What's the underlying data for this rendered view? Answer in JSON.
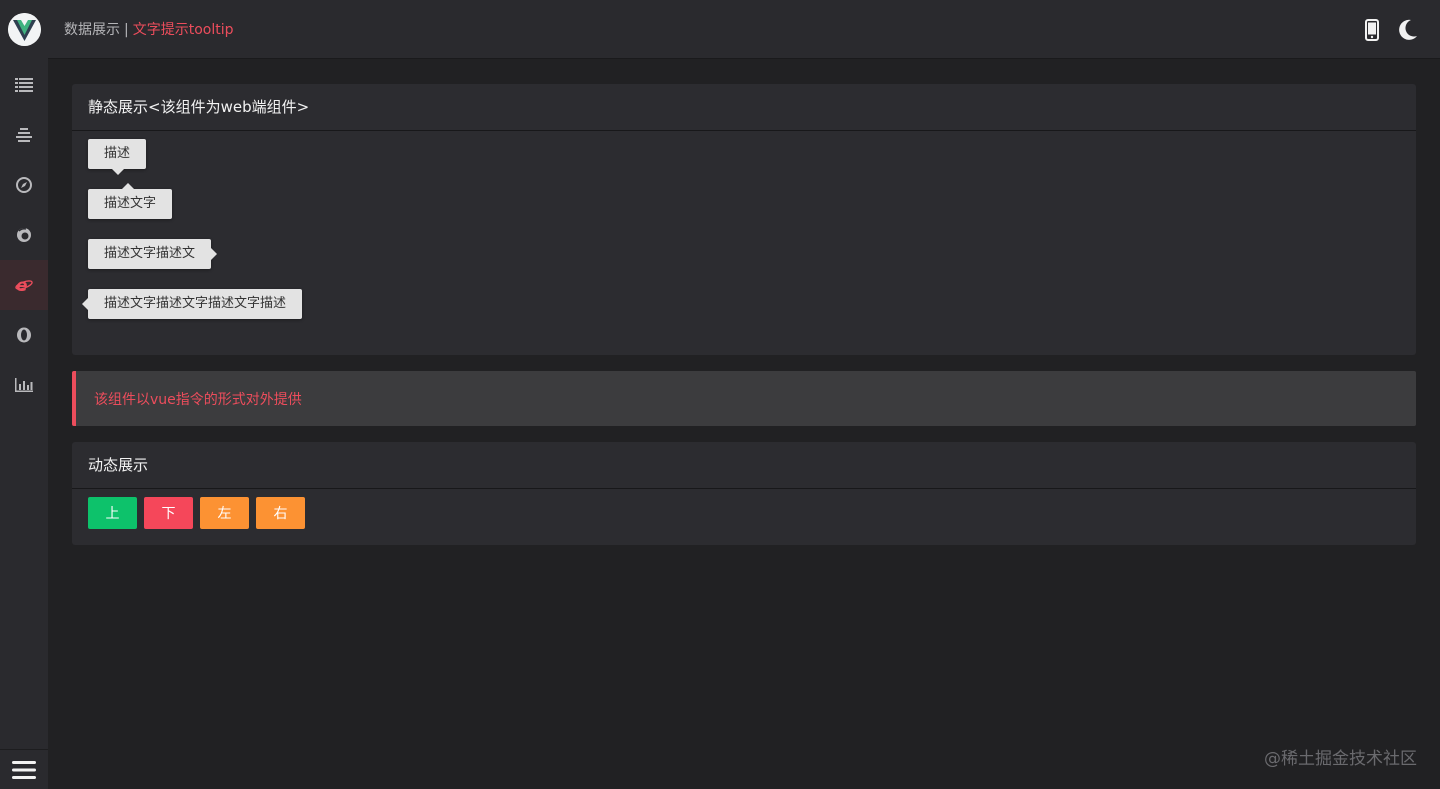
{
  "header": {
    "breadcrumb_home": "数据展示",
    "breadcrumb_separator": "|",
    "breadcrumb_current": "文字提示tooltip",
    "actions": [
      {
        "icon": "mobile-icon"
      },
      {
        "icon": "moon-icon"
      }
    ]
  },
  "sidebar": {
    "logo_icon": "vue-logo-icon",
    "items": [
      {
        "icon": "list-icon",
        "active": false
      },
      {
        "icon": "align-center-icon",
        "active": false
      },
      {
        "icon": "compass-icon",
        "active": false
      },
      {
        "icon": "firefox-icon",
        "active": false
      },
      {
        "icon": "ie-browser-icon",
        "active": true
      },
      {
        "icon": "opera-icon",
        "active": false
      },
      {
        "icon": "bar-chart-icon",
        "active": false
      }
    ],
    "menu_toggle_icon": "hamburger-menu-icon"
  },
  "static_demo": {
    "title": "静态展示<该组件为web端组件>",
    "tooltips": [
      {
        "text": "描述",
        "placement": "top"
      },
      {
        "text": "描述文字",
        "placement": "bottom"
      },
      {
        "text": "描述文字描述文",
        "placement": "left"
      },
      {
        "text": "描述文字描述文字描述文字描述",
        "placement": "right"
      }
    ]
  },
  "notice": {
    "text": "该组件以vue指令的形式对外提供"
  },
  "dynamic_demo": {
    "title": "动态展示",
    "buttons": [
      {
        "label": "上",
        "color": "#0dc26b"
      },
      {
        "label": "下",
        "color": "#f5475a"
      },
      {
        "label": "左",
        "color": "#fc9233"
      },
      {
        "label": "右",
        "color": "#fc9233"
      }
    ]
  },
  "watermark": "@稀土掘金技术社区",
  "colors": {
    "accent": "#ec4d5c",
    "background": "#212123",
    "panel": "#2c2c30",
    "sidebar": "#2a2a2e"
  }
}
